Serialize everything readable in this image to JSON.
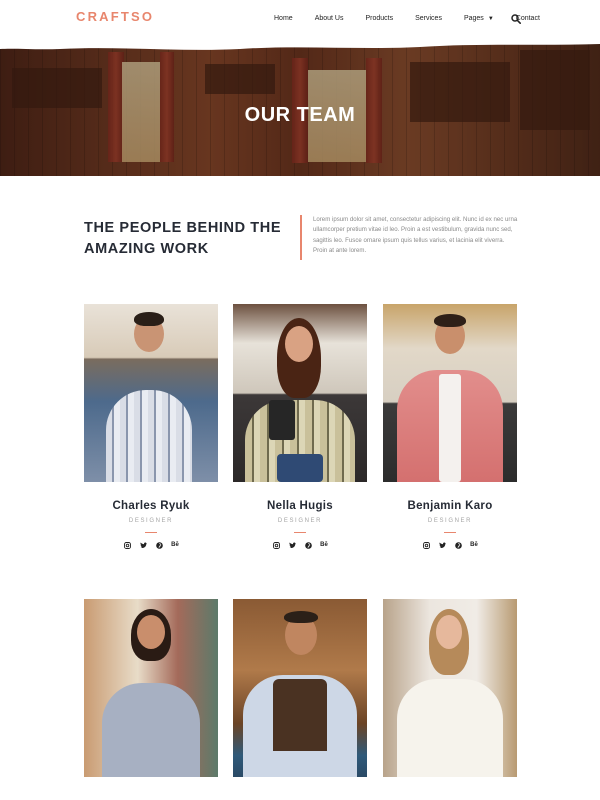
{
  "brand": {
    "logo": "CRAFTSO",
    "accent": "#e8866d"
  },
  "nav": {
    "items": [
      "Home",
      "About Us",
      "Products",
      "Services",
      "Pages",
      "Contact"
    ],
    "pages_caret_icon": "caret-down-icon",
    "search_icon": "search-icon"
  },
  "hero": {
    "title": "OUR TEAM"
  },
  "intro": {
    "heading": "THE PEOPLE BEHIND THE AMAZING WORK",
    "body": "Lorem ipsum dolor sit amet, consectetur adipiscing elit. Nunc id ex nec urna ullamcorper pretium vitae id leo. Proin a est vestibulum, gravida nunc sed, sagittis leo. Fusce ornare ipsum quis tellus varius, et lacinia elit viverra. Proin at ante lorem."
  },
  "team": [
    {
      "name": "Charles Ryuk",
      "role": "DESIGNER"
    },
    {
      "name": "Nella Hugis",
      "role": "DESIGNER"
    },
    {
      "name": "Benjamin Karo",
      "role": "DESIGNER"
    }
  ],
  "social_icons": [
    "instagram-icon",
    "twitter-icon",
    "pinterest-icon",
    "behance-icon"
  ],
  "behance_label": "Bē"
}
